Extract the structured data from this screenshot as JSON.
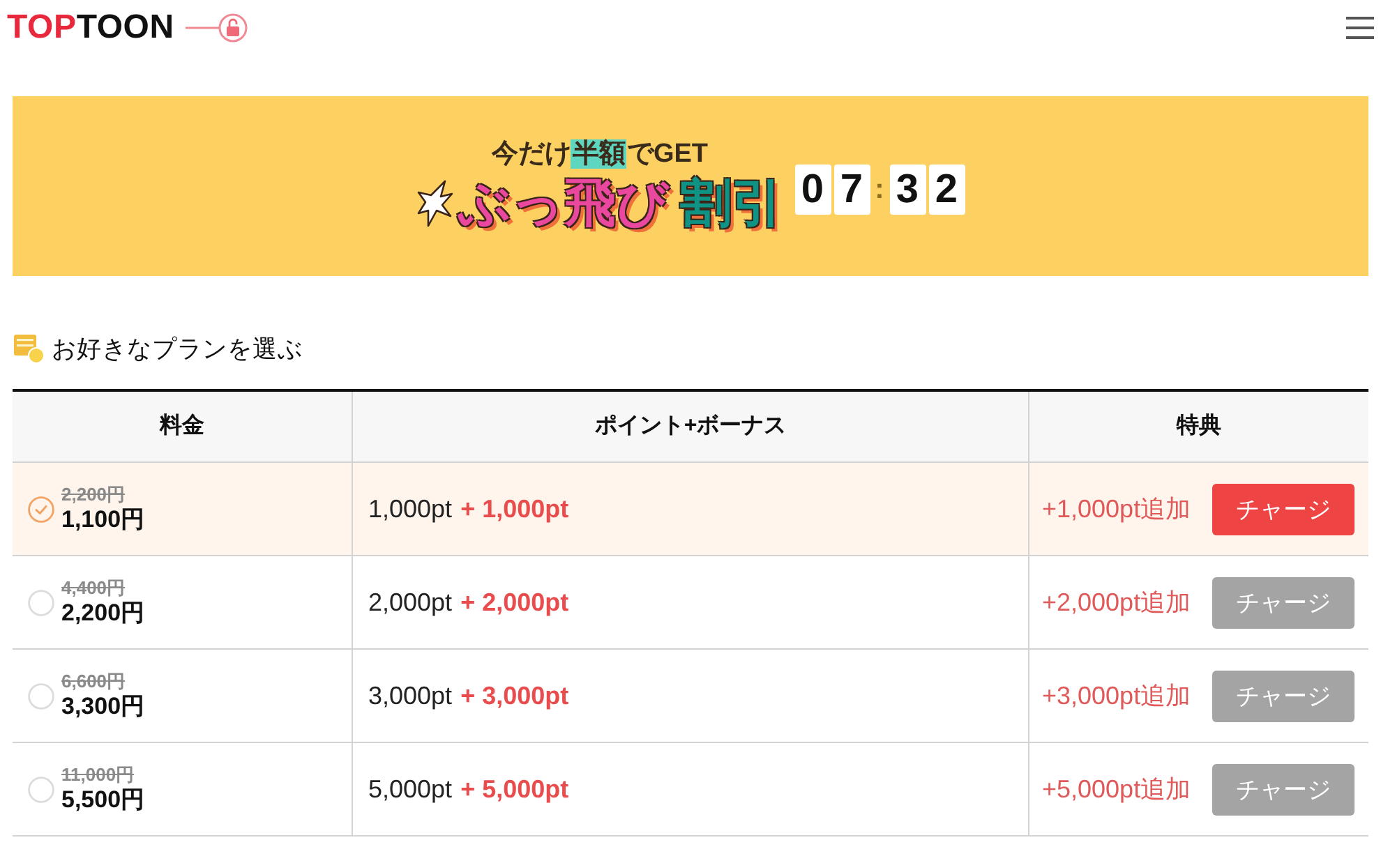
{
  "header": {
    "logo": [
      {
        "text": "TOP",
        "color": "#e8283c"
      },
      {
        "text": "TOON",
        "color": "#111111"
      }
    ]
  },
  "banner": {
    "tagline": [
      {
        "text": "今だけ",
        "highlight": false
      },
      {
        "text": "半額",
        "highlight": true
      },
      {
        "text": "でGET",
        "highlight": false
      }
    ],
    "title": [
      {
        "text": "ぶっ飛び",
        "color": "#e9489e"
      },
      {
        "text": "割引",
        "color": "#0f9384"
      }
    ],
    "timer": [
      {
        "text": "0",
        "kind": "digit"
      },
      {
        "text": "7",
        "kind": "digit"
      },
      {
        "text": ":",
        "kind": "separator"
      },
      {
        "text": "3",
        "kind": "digit"
      },
      {
        "text": "2",
        "kind": "digit"
      }
    ]
  },
  "section_title": "お好きなプランを選ぶ",
  "table": {
    "columns": [
      "料金",
      "ポイント+ボーナス",
      "特典"
    ],
    "rows": [
      {
        "selected": true,
        "original_price": "2,200円",
        "price": "1,100円",
        "points": "1,000pt",
        "bonus": "+ 1,000pt",
        "benefit": "+1,000pt追加",
        "button": "チャージ"
      },
      {
        "selected": false,
        "original_price": "4,400円",
        "price": "2,200円",
        "points": "2,000pt",
        "bonus": "+ 2,000pt",
        "benefit": "+2,000pt追加",
        "button": "チャージ"
      },
      {
        "selected": false,
        "original_price": "6,600円",
        "price": "3,300円",
        "points": "3,000pt",
        "bonus": "+ 3,000pt",
        "benefit": "+3,000pt追加",
        "button": "チャージ"
      },
      {
        "selected": false,
        "original_price": "11,000円",
        "price": "5,500円",
        "points": "5,000pt",
        "bonus": "+ 5,000pt",
        "benefit": "+5,000pt追加",
        "button": "チャージ"
      }
    ]
  }
}
